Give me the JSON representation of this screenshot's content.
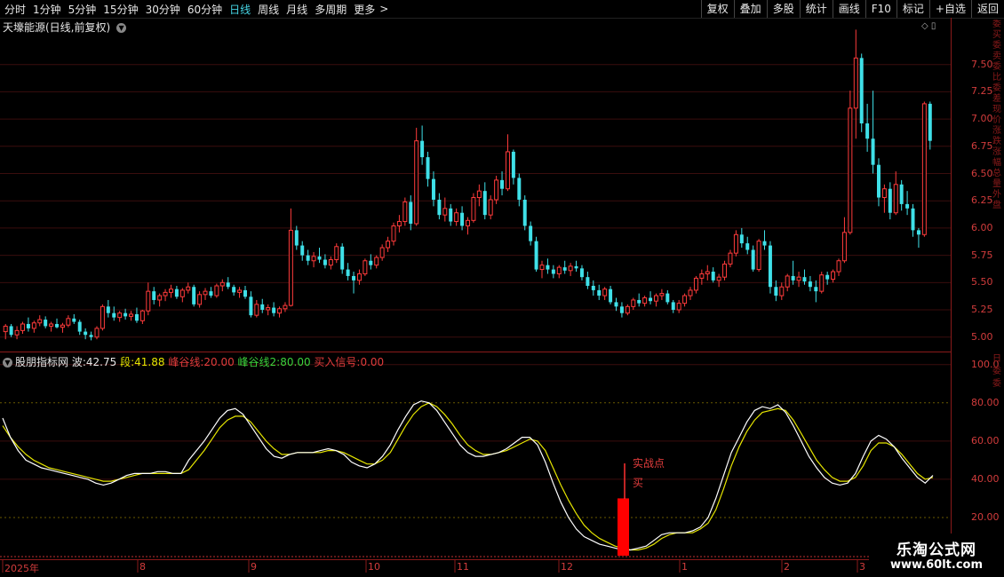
{
  "toolbar": {
    "periods": [
      "分时",
      "1分钟",
      "5分钟",
      "15分钟",
      "30分钟",
      "60分钟",
      "日线",
      "周线",
      "月线",
      "多周期",
      "更多"
    ],
    "active_period": "日线",
    "more_arrow": ">",
    "right_buttons": [
      "复权",
      "叠加",
      "多股",
      "统计",
      "画线",
      "F10",
      "标记",
      "+自选",
      "返回"
    ]
  },
  "main_chart": {
    "title": "天壕能源(日线,前复权)",
    "price_axis_ticks": [
      "7.50",
      "7.25",
      "7.00",
      "6.75",
      "6.50",
      "6.25",
      "6.00",
      "5.75",
      "5.50",
      "5.25",
      "5.00"
    ],
    "colors": {
      "up": "#ff3b3b",
      "down": "#3fe0e8"
    }
  },
  "indicator": {
    "name": "股朋指标网",
    "wave_label": "波:",
    "wave_value": "42.75",
    "segment_label": "段:",
    "segment_value": "41.88",
    "fenggu1_label": "峰谷线:",
    "fenggu1_value": "20.00",
    "fenggu2_label": "峰谷线2:",
    "fenggu2_value": "80.00",
    "buy_signal_label": "买入信号:",
    "buy_signal_value": "0.00",
    "axis_ticks": [
      "100.0",
      "80.00",
      "60.00",
      "40.00",
      "20.00"
    ],
    "annotation_main": "实战点",
    "annotation_buy": "买",
    "colors": {
      "wave": "#ffffff",
      "segment": "#e6e600",
      "signal": "#ff0000"
    }
  },
  "x_axis": {
    "labels": [
      "2025年",
      "8",
      "9",
      "10",
      "11",
      "12",
      "1",
      "2",
      "3"
    ]
  },
  "right_strip": {
    "top_text": "委买委卖委比委差现价涨跌涨幅总量外盘",
    "bottom_text": "日委委"
  },
  "watermark": {
    "line1": "乐淘公式网",
    "line2": "www.60lt.com"
  },
  "chart_data": {
    "type": "candlestick",
    "candles": [
      [
        5.05,
        5.12,
        4.98,
        5.1
      ],
      [
        5.1,
        5.12,
        5.0,
        5.02
      ],
      [
        5.02,
        5.1,
        4.98,
        5.06
      ],
      [
        5.06,
        5.14,
        5.03,
        5.12
      ],
      [
        5.12,
        5.18,
        5.05,
        5.08
      ],
      [
        5.08,
        5.15,
        5.04,
        5.13
      ],
      [
        5.13,
        5.2,
        5.1,
        5.16
      ],
      [
        5.16,
        5.19,
        5.08,
        5.1
      ],
      [
        5.1,
        5.14,
        5.05,
        5.12
      ],
      [
        5.12,
        5.17,
        5.08,
        5.09
      ],
      [
        5.09,
        5.13,
        5.04,
        5.11
      ],
      [
        5.11,
        5.2,
        5.09,
        5.17
      ],
      [
        5.17,
        5.21,
        5.12,
        5.14
      ],
      [
        5.14,
        5.16,
        5.02,
        5.05
      ],
      [
        5.05,
        5.08,
        4.98,
        5.02
      ],
      [
        5.02,
        5.05,
        4.97,
        5.0
      ],
      [
        5.0,
        5.1,
        4.98,
        5.08
      ],
      [
        5.08,
        5.3,
        5.06,
        5.28
      ],
      [
        5.28,
        5.34,
        5.18,
        5.22
      ],
      [
        5.22,
        5.28,
        5.15,
        5.18
      ],
      [
        5.18,
        5.24,
        5.14,
        5.22
      ],
      [
        5.22,
        5.26,
        5.16,
        5.19
      ],
      [
        5.19,
        5.24,
        5.15,
        5.21
      ],
      [
        5.21,
        5.27,
        5.13,
        5.15
      ],
      [
        5.15,
        5.25,
        5.12,
        5.24
      ],
      [
        5.24,
        5.5,
        5.2,
        5.42
      ],
      [
        5.42,
        5.46,
        5.3,
        5.34
      ],
      [
        5.34,
        5.4,
        5.28,
        5.38
      ],
      [
        5.38,
        5.44,
        5.33,
        5.41
      ],
      [
        5.41,
        5.48,
        5.36,
        5.44
      ],
      [
        5.44,
        5.47,
        5.35,
        5.37
      ],
      [
        5.37,
        5.45,
        5.32,
        5.43
      ],
      [
        5.43,
        5.5,
        5.4,
        5.46
      ],
      [
        5.46,
        5.48,
        5.28,
        5.3
      ],
      [
        5.3,
        5.42,
        5.27,
        5.39
      ],
      [
        5.39,
        5.45,
        5.34,
        5.42
      ],
      [
        5.42,
        5.46,
        5.36,
        5.38
      ],
      [
        5.38,
        5.49,
        5.36,
        5.47
      ],
      [
        5.47,
        5.53,
        5.42,
        5.5
      ],
      [
        5.5,
        5.55,
        5.44,
        5.46
      ],
      [
        5.46,
        5.48,
        5.38,
        5.41
      ],
      [
        5.41,
        5.46,
        5.36,
        5.43
      ],
      [
        5.43,
        5.47,
        5.35,
        5.37
      ],
      [
        5.37,
        5.42,
        5.18,
        5.2
      ],
      [
        5.2,
        5.34,
        5.18,
        5.3
      ],
      [
        5.3,
        5.35,
        5.22,
        5.25
      ],
      [
        5.25,
        5.3,
        5.2,
        5.27
      ],
      [
        5.27,
        5.32,
        5.19,
        5.22
      ],
      [
        5.22,
        5.28,
        5.18,
        5.26
      ],
      [
        5.26,
        5.32,
        5.23,
        5.29
      ],
      [
        5.29,
        6.18,
        5.28,
        5.98
      ],
      [
        5.98,
        6.02,
        5.8,
        5.84
      ],
      [
        5.84,
        5.88,
        5.7,
        5.75
      ],
      [
        5.75,
        5.8,
        5.66,
        5.7
      ],
      [
        5.7,
        5.78,
        5.64,
        5.74
      ],
      [
        5.74,
        5.82,
        5.68,
        5.71
      ],
      [
        5.71,
        5.76,
        5.63,
        5.66
      ],
      [
        5.66,
        5.74,
        5.62,
        5.71
      ],
      [
        5.71,
        5.86,
        5.68,
        5.83
      ],
      [
        5.83,
        5.86,
        5.58,
        5.62
      ],
      [
        5.62,
        5.68,
        5.52,
        5.56
      ],
      [
        5.56,
        5.6,
        5.4,
        5.52
      ],
      [
        5.52,
        5.62,
        5.48,
        5.58
      ],
      [
        5.58,
        5.72,
        5.56,
        5.7
      ],
      [
        5.7,
        5.76,
        5.62,
        5.66
      ],
      [
        5.66,
        5.75,
        5.63,
        5.73
      ],
      [
        5.73,
        5.85,
        5.7,
        5.82
      ],
      [
        5.82,
        5.92,
        5.78,
        5.88
      ],
      [
        5.88,
        6.05,
        5.84,
        6.02
      ],
      [
        6.02,
        6.12,
        5.96,
        6.06
      ],
      [
        6.06,
        6.28,
        6.02,
        6.24
      ],
      [
        6.24,
        6.3,
        5.98,
        6.04
      ],
      [
        6.04,
        6.92,
        6.02,
        6.8
      ],
      [
        6.8,
        6.94,
        6.58,
        6.65
      ],
      [
        6.65,
        6.7,
        6.38,
        6.45
      ],
      [
        6.45,
        6.52,
        6.2,
        6.26
      ],
      [
        6.26,
        6.32,
        6.08,
        6.12
      ],
      [
        6.12,
        6.28,
        6.06,
        6.18
      ],
      [
        6.18,
        6.22,
        6.02,
        6.06
      ],
      [
        6.06,
        6.18,
        6.02,
        6.14
      ],
      [
        6.14,
        6.2,
        5.98,
        6.02
      ],
      [
        6.02,
        6.1,
        5.94,
        6.07
      ],
      [
        6.07,
        6.32,
        6.05,
        6.28
      ],
      [
        6.28,
        6.4,
        6.2,
        6.34
      ],
      [
        6.34,
        6.42,
        6.08,
        6.12
      ],
      [
        6.12,
        6.3,
        6.08,
        6.26
      ],
      [
        6.26,
        6.48,
        6.22,
        6.44
      ],
      [
        6.44,
        6.52,
        6.3,
        6.36
      ],
      [
        6.36,
        6.86,
        6.34,
        6.7
      ],
      [
        6.7,
        6.72,
        6.4,
        6.46
      ],
      [
        6.46,
        6.5,
        6.2,
        6.26
      ],
      [
        6.26,
        6.3,
        5.98,
        6.02
      ],
      [
        6.02,
        6.06,
        5.84,
        5.88
      ],
      [
        5.88,
        5.92,
        5.6,
        5.62
      ],
      [
        5.62,
        5.7,
        5.54,
        5.66
      ],
      [
        5.66,
        5.72,
        5.58,
        5.62
      ],
      [
        5.62,
        5.66,
        5.54,
        5.58
      ],
      [
        5.58,
        5.66,
        5.54,
        5.64
      ],
      [
        5.64,
        5.7,
        5.58,
        5.61
      ],
      [
        5.61,
        5.68,
        5.56,
        5.65
      ],
      [
        5.65,
        5.7,
        5.6,
        5.63
      ],
      [
        5.63,
        5.66,
        5.52,
        5.55
      ],
      [
        5.55,
        5.6,
        5.44,
        5.47
      ],
      [
        5.47,
        5.52,
        5.38,
        5.43
      ],
      [
        5.43,
        5.48,
        5.34,
        5.38
      ],
      [
        5.38,
        5.46,
        5.34,
        5.44
      ],
      [
        5.44,
        5.47,
        5.3,
        5.32
      ],
      [
        5.32,
        5.36,
        5.24,
        5.28
      ],
      [
        5.28,
        5.32,
        5.18,
        5.22
      ],
      [
        5.22,
        5.3,
        5.2,
        5.28
      ],
      [
        5.28,
        5.36,
        5.25,
        5.34
      ],
      [
        5.34,
        5.4,
        5.28,
        5.31
      ],
      [
        5.31,
        5.38,
        5.28,
        5.36
      ],
      [
        5.36,
        5.42,
        5.3,
        5.33
      ],
      [
        5.33,
        5.4,
        5.28,
        5.38
      ],
      [
        5.38,
        5.44,
        5.34,
        5.4
      ],
      [
        5.4,
        5.43,
        5.3,
        5.32
      ],
      [
        5.32,
        5.34,
        5.22,
        5.25
      ],
      [
        5.25,
        5.34,
        5.22,
        5.31
      ],
      [
        5.31,
        5.4,
        5.28,
        5.38
      ],
      [
        5.38,
        5.46,
        5.34,
        5.43
      ],
      [
        5.43,
        5.56,
        5.4,
        5.54
      ],
      [
        5.54,
        5.62,
        5.48,
        5.58
      ],
      [
        5.58,
        5.66,
        5.52,
        5.6
      ],
      [
        5.6,
        5.64,
        5.5,
        5.52
      ],
      [
        5.52,
        5.58,
        5.46,
        5.55
      ],
      [
        5.55,
        5.7,
        5.52,
        5.67
      ],
      [
        5.67,
        5.8,
        5.64,
        5.77
      ],
      [
        5.77,
        5.98,
        5.74,
        5.94
      ],
      [
        5.94,
        6.0,
        5.82,
        5.86
      ],
      [
        5.86,
        5.92,
        5.76,
        5.8
      ],
      [
        5.8,
        5.84,
        5.6,
        5.62
      ],
      [
        5.62,
        5.9,
        5.6,
        5.88
      ],
      [
        5.88,
        5.98,
        5.8,
        5.84
      ],
      [
        5.84,
        5.88,
        5.4,
        5.46
      ],
      [
        5.46,
        5.52,
        5.33,
        5.38
      ],
      [
        5.38,
        5.5,
        5.34,
        5.46
      ],
      [
        5.46,
        5.58,
        5.42,
        5.56
      ],
      [
        5.56,
        5.7,
        5.48,
        5.52
      ],
      [
        5.52,
        5.6,
        5.46,
        5.55
      ],
      [
        5.55,
        5.62,
        5.48,
        5.51
      ],
      [
        5.51,
        5.56,
        5.42,
        5.46
      ],
      [
        5.46,
        5.52,
        5.32,
        5.42
      ],
      [
        5.42,
        5.6,
        5.4,
        5.57
      ],
      [
        5.57,
        5.6,
        5.48,
        5.53
      ],
      [
        5.53,
        5.62,
        5.5,
        5.6
      ],
      [
        5.6,
        5.72,
        5.56,
        5.7
      ],
      [
        5.7,
        6.1,
        5.68,
        5.96
      ],
      [
        5.96,
        7.26,
        5.94,
        7.1
      ],
      [
        7.1,
        7.82,
        6.82,
        7.56
      ],
      [
        7.56,
        7.6,
        6.88,
        6.96
      ],
      [
        6.96,
        7.14,
        6.7,
        6.82
      ],
      [
        6.82,
        7.26,
        6.5,
        6.58
      ],
      [
        6.58,
        6.64,
        6.2,
        6.28
      ],
      [
        6.28,
        6.4,
        6.14,
        6.36
      ],
      [
        6.36,
        6.42,
        6.08,
        6.14
      ],
      [
        6.14,
        6.52,
        6.12,
        6.4
      ],
      [
        6.4,
        6.44,
        6.16,
        6.22
      ],
      [
        6.22,
        6.34,
        6.12,
        6.18
      ],
      [
        6.18,
        6.22,
        5.92,
        5.98
      ],
      [
        5.98,
        6.0,
        5.82,
        5.94
      ],
      [
        5.94,
        7.16,
        5.92,
        7.14
      ],
      [
        7.14,
        7.16,
        6.72,
        6.8
      ]
    ],
    "ylim": [
      4.9,
      7.75
    ],
    "indicator_wave": [
      72,
      62,
      55,
      50,
      48,
      46,
      45,
      44,
      43,
      42,
      41,
      40,
      38,
      37,
      38,
      40,
      42,
      43,
      43,
      43,
      44,
      44,
      43,
      43,
      50,
      55,
      60,
      66,
      72,
      76,
      77,
      74,
      68,
      62,
      56,
      52,
      51,
      53,
      54,
      54,
      54,
      55,
      56,
      55,
      53,
      49,
      47,
      46,
      48,
      52,
      58,
      66,
      73,
      79,
      81,
      80,
      76,
      70,
      64,
      58,
      54,
      52,
      52,
      53,
      54,
      56,
      59,
      62,
      62,
      58,
      49,
      38,
      28,
      20,
      14,
      10,
      8,
      6,
      5,
      4,
      3,
      3,
      4,
      5,
      8,
      11,
      12,
      12,
      12,
      13,
      15,
      20,
      30,
      42,
      54,
      62,
      70,
      76,
      78,
      77,
      79,
      75,
      68,
      60,
      52,
      46,
      41,
      38,
      37,
      38,
      43,
      52,
      60,
      63,
      61,
      57,
      51,
      46,
      41,
      38,
      42
    ],
    "indicator_segment": [
      68,
      62,
      57,
      53,
      50,
      48,
      46,
      45,
      44,
      43,
      42,
      41,
      40,
      39,
      39,
      40,
      41,
      42,
      43,
      43,
      43,
      43,
      43,
      43,
      45,
      50,
      55,
      61,
      67,
      71,
      73,
      73,
      70,
      65,
      60,
      56,
      53,
      53,
      54,
      54,
      54,
      54,
      55,
      55,
      54,
      52,
      50,
      48,
      48,
      50,
      54,
      61,
      68,
      74,
      78,
      80,
      78,
      74,
      69,
      63,
      58,
      55,
      53,
      53,
      54,
      55,
      57,
      59,
      61,
      60,
      55,
      46,
      37,
      29,
      22,
      16,
      12,
      9,
      7,
      5,
      4,
      3,
      3,
      4,
      6,
      9,
      11,
      12,
      12,
      12,
      14,
      17,
      24,
      35,
      47,
      57,
      65,
      71,
      75,
      76,
      77,
      76,
      71,
      64,
      57,
      50,
      45,
      41,
      39,
      39,
      41,
      47,
      55,
      59,
      59,
      57,
      53,
      48,
      43,
      40,
      41
    ],
    "buy_signal": {
      "index": 80,
      "value": 30
    },
    "indicator_ylim": [
      0,
      105
    ],
    "reference_lines": [
      20,
      80
    ]
  }
}
